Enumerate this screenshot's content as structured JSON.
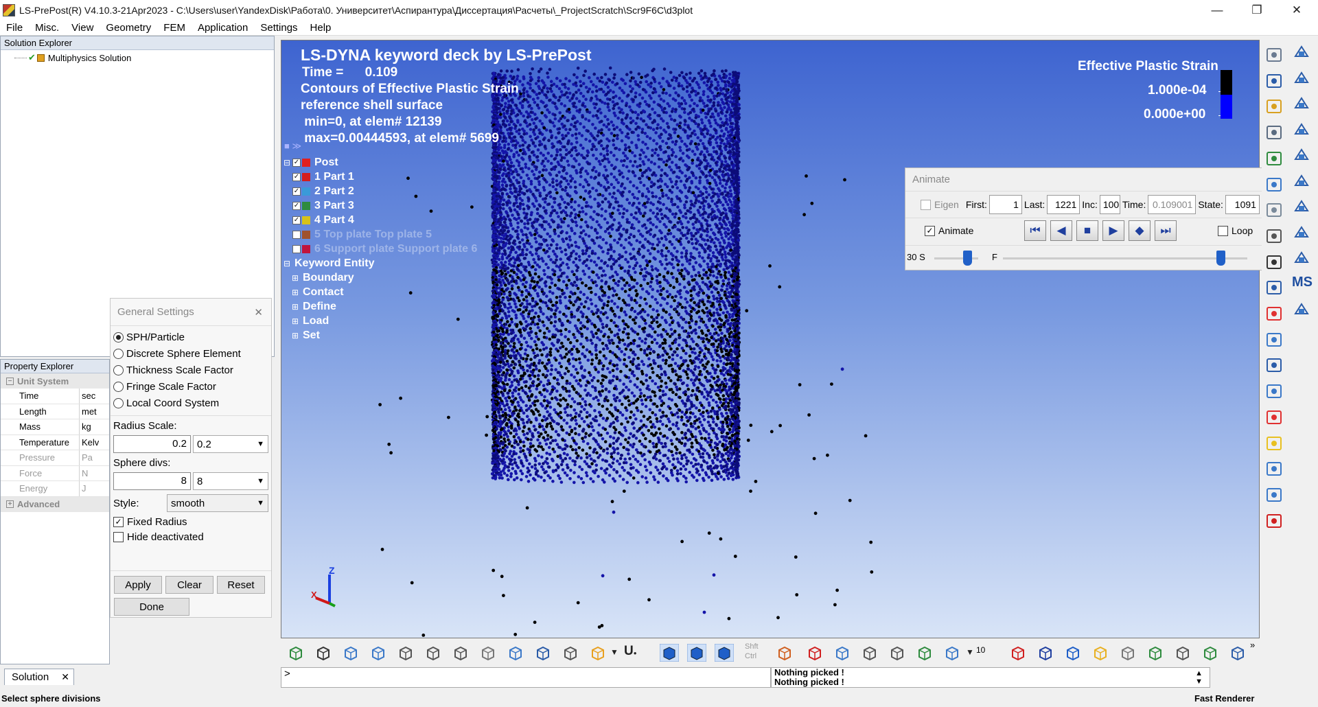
{
  "window": {
    "title": "LS-PrePost(R) V4.10.3-21Apr2023 - C:\\Users\\user\\YandexDisk\\Работа\\0. Университет\\Аспирантура\\Диссертация\\Расчеты\\_ProjectScratch\\Scr9F6C\\d3plot",
    "minimize": "—",
    "restore": "❐",
    "close": "✕"
  },
  "menu": [
    "File",
    "Misc.",
    "View",
    "Geometry",
    "FEM",
    "Application",
    "Settings",
    "Help"
  ],
  "solution_explorer": {
    "title": "Solution Explorer",
    "root_item": "Multiphysics Solution",
    "tab_label": "Solution"
  },
  "property_explorer": {
    "title": "Property Explorer",
    "group_unit_system": "Unit System",
    "rows": [
      {
        "key": "Time",
        "value": "sec",
        "enabled": true
      },
      {
        "key": "Length",
        "value": "met",
        "enabled": true
      },
      {
        "key": "Mass",
        "value": "kg",
        "enabled": true
      },
      {
        "key": "Temperature",
        "value": "Kelv",
        "enabled": true
      },
      {
        "key": "Pressure",
        "value": "Pa",
        "enabled": false
      },
      {
        "key": "Force",
        "value": "N",
        "enabled": false
      },
      {
        "key": "Energy",
        "value": "J",
        "enabled": false
      }
    ],
    "group_advanced": "Advanced"
  },
  "general_settings": {
    "title": "General Settings",
    "radios": [
      {
        "label": "SPH/Particle",
        "checked": true
      },
      {
        "label": "Discrete Sphere Element",
        "checked": false
      },
      {
        "label": "Thickness Scale Factor",
        "checked": false
      },
      {
        "label": "Fringe Scale Factor",
        "checked": false
      },
      {
        "label": "Local Coord System",
        "checked": false
      }
    ],
    "radius_scale_label": "Radius Scale:",
    "radius_scale_value": "0.2",
    "radius_scale_select": "0.2",
    "sphere_divs_label": "Sphere divs:",
    "sphere_divs_value": "8",
    "sphere_divs_select": "8",
    "style_label": "Style:",
    "style_value": "smooth",
    "fixed_radius_label": "Fixed Radius",
    "fixed_radius_checked": true,
    "hide_deactivated_label": "Hide deactivated",
    "hide_deactivated_checked": false,
    "apply": "Apply",
    "clear": "Clear",
    "reset": "Reset",
    "done": "Done"
  },
  "viewport": {
    "header_line1": "LS-DYNA keyword deck by LS-PrePost",
    "time_label": "Time =",
    "time_value": "0.109",
    "line3": "Contours of Effective Plastic Strain",
    "line4": "reference shell surface",
    "line5": " min=0, at elem# 12139",
    "line6": " max=0.00444593, at elem# 5699",
    "legend_title": "Effective Plastic Strain",
    "legend_max": "1.000e-04",
    "legend_min": "0.000e+00",
    "legend_colors": [
      "#000000",
      "#0000ff"
    ],
    "tree": {
      "post": "Post",
      "parts": [
        {
          "label": "1 Part 1",
          "color": "#d41d1d",
          "checked": true,
          "visible": true
        },
        {
          "label": "2 Part 2",
          "color": "#3a9ad9",
          "checked": true,
          "visible": true
        },
        {
          "label": "3 Part 3",
          "color": "#2e8b3e",
          "checked": true,
          "visible": true
        },
        {
          "label": "4 Part 4",
          "color": "#d8c21a",
          "checked": true,
          "visible": true
        },
        {
          "label": "5 Top plate Top plate 5",
          "color": "#a0522d",
          "checked": false,
          "visible": false
        },
        {
          "label": "6 Support plate Support plate 6",
          "color": "#c0143c",
          "checked": false,
          "visible": false
        }
      ],
      "keyword_entity": "Keyword Entity",
      "keyword_children": [
        "Boundary",
        "Contact",
        "Define",
        "Load",
        "Set"
      ]
    },
    "triad": {
      "x": "X",
      "z": "Z"
    }
  },
  "animate": {
    "title": "Animate",
    "eigen_label": "Eigen",
    "eigen_checked": false,
    "first_label": "First:",
    "first_value": "1",
    "last_label": "Last:",
    "last_value": "1221",
    "inc_label": "Inc:",
    "inc_value": "100",
    "time_label": "Time:",
    "time_value": "0.109001",
    "state_label": "State:",
    "state_value": "1091",
    "animate_label": "Animate",
    "animate_checked": true,
    "loop_label": "Loop",
    "loop_checked": false,
    "speed_s_label": "30 S",
    "speed_f_label": "F",
    "more_label": ">>",
    "speed_fraction": 0.25,
    "frame_fraction": 0.89
  },
  "bottom_toolbar": {
    "shft_label": "Shft",
    "ctrl_label": "Ctrl",
    "count_label": "10"
  },
  "command_line": {
    "prompt": ">"
  },
  "messages": [
    "Nothing picked !",
    "Nothing picked !"
  ],
  "status": {
    "left": "Select sphere divisions",
    "right": "Fast Renderer"
  },
  "colors": {
    "viewport_top": "#3e64d0",
    "viewport_bottom": "#d8e4f7",
    "particle_blue": "#1414a8",
    "particle_black": "#000000"
  }
}
